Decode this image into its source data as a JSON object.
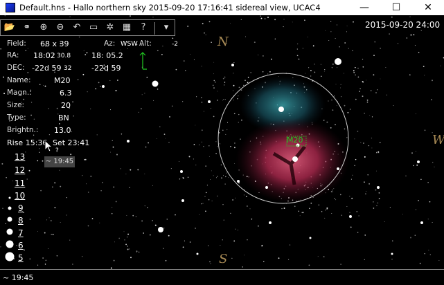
{
  "window": {
    "title": "Default.hns - Hallo northern sky   2015-09-20  17:16:41   sidereal view,   UCAC4",
    "minimize_glyph": "—",
    "maximize_glyph": "☐",
    "close_glyph": "✕"
  },
  "toolbar": {
    "buttons": [
      {
        "name": "open-folder",
        "glyph": "📂"
      },
      {
        "name": "binoculars",
        "glyph": "⚭"
      },
      {
        "name": "zoom-in",
        "glyph": "⊕"
      },
      {
        "name": "zoom-out",
        "glyph": "⊖"
      },
      {
        "name": "undo",
        "glyph": "↶"
      },
      {
        "name": "screen",
        "glyph": "▭"
      },
      {
        "name": "star-field",
        "glyph": "✲"
      },
      {
        "name": "calculator",
        "glyph": "▦"
      },
      {
        "name": "help",
        "glyph": "?"
      },
      {
        "name": "dropdown",
        "glyph": "▾"
      }
    ]
  },
  "datetime": "2015-09-20  24:00",
  "info": {
    "field_label": "Field:",
    "field_value": "68  x   39",
    "az_label": "Az:",
    "az_value": "WSW",
    "alt_label": "Alt:",
    "alt_value": "-2",
    "ra_label": "RA:",
    "ra_value": "18:02",
    "ra_sub": "30.8",
    "ra_value2": "18: 05.2",
    "dec_label": "DEC:",
    "dec_value": "-22d 59",
    "dec_sub": "32",
    "dec_value2": "-22d 59",
    "name_label": "Name:",
    "name_value": "M20",
    "magn_label": "Magn.:",
    "magn_value": "6.3",
    "size_label": "Size:",
    "size_value": "20",
    "type_label": "Type:",
    "type_value": "BN",
    "brightn_label": "Brightn.:",
    "brightn_value": "13.0",
    "rise": "Rise 15:36",
    "set": "Set 23:41"
  },
  "object_label": "M20",
  "compass": {
    "n": "N",
    "s": "S",
    "w": "W"
  },
  "magnitude_scale": [
    "13",
    "12",
    "11",
    "10",
    "9",
    "8",
    "7",
    "6",
    "5"
  ],
  "tooltip": "~ 19:45",
  "cursor_hint": "?",
  "status": "~ 19:45",
  "colors": {
    "nebula_red": "#c23a5a",
    "nebula_blue": "#2a8a8a",
    "label_green": "#22cc22",
    "compass": "#a88a55"
  }
}
